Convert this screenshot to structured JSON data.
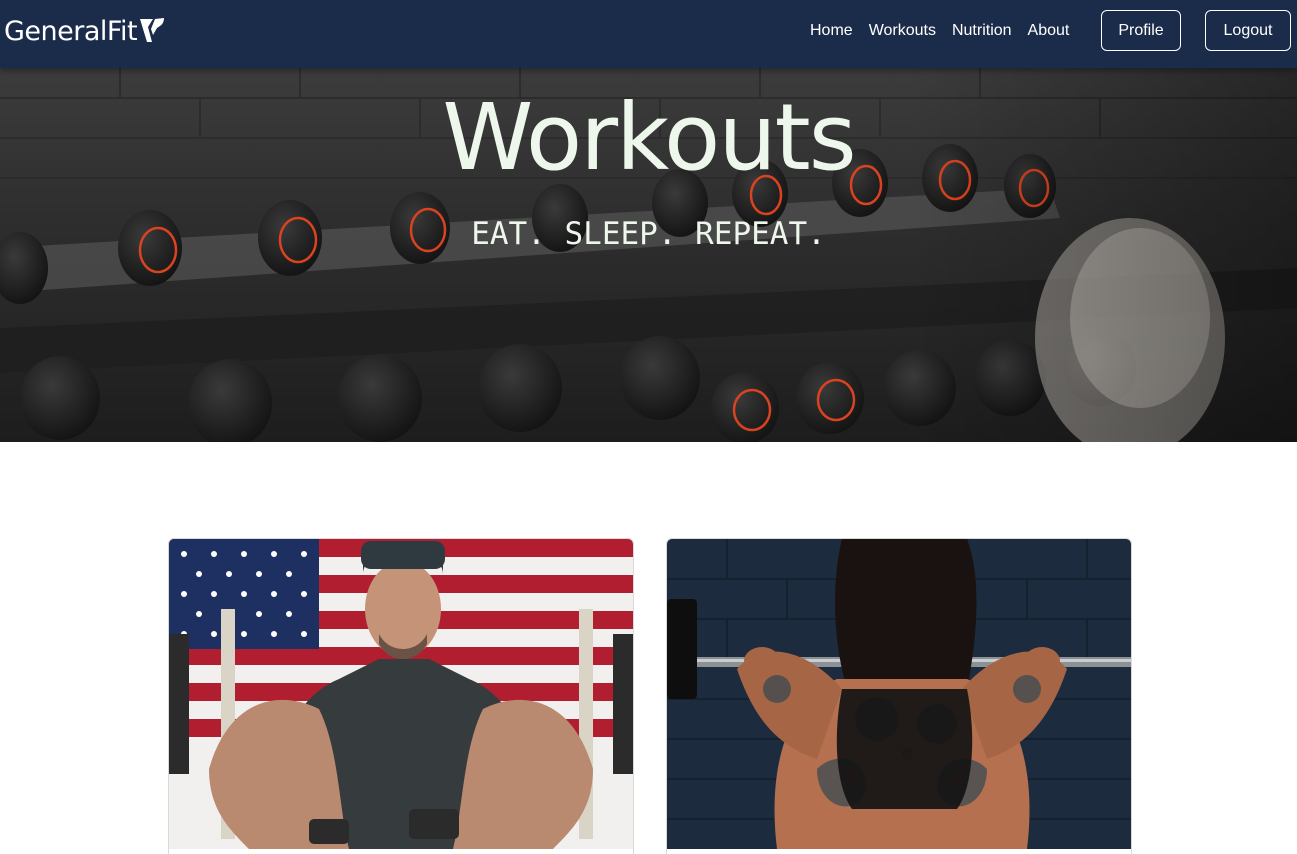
{
  "navbar": {
    "brand": "GeneralFit",
    "links": [
      "Home",
      "Workouts",
      "Nutrition",
      "About"
    ],
    "profile_label": "Profile",
    "logout_label": "Logout",
    "background": "#1b2c4a"
  },
  "hero": {
    "title": "Workouts",
    "subtitle": "EAT. SLEEP. REPEAT.",
    "image": "dumbbell-rack-photo"
  },
  "cards": [
    {
      "image": "bodybuilder-flag-photo"
    },
    {
      "image": "tattooed-woman-barbell-photo"
    }
  ]
}
